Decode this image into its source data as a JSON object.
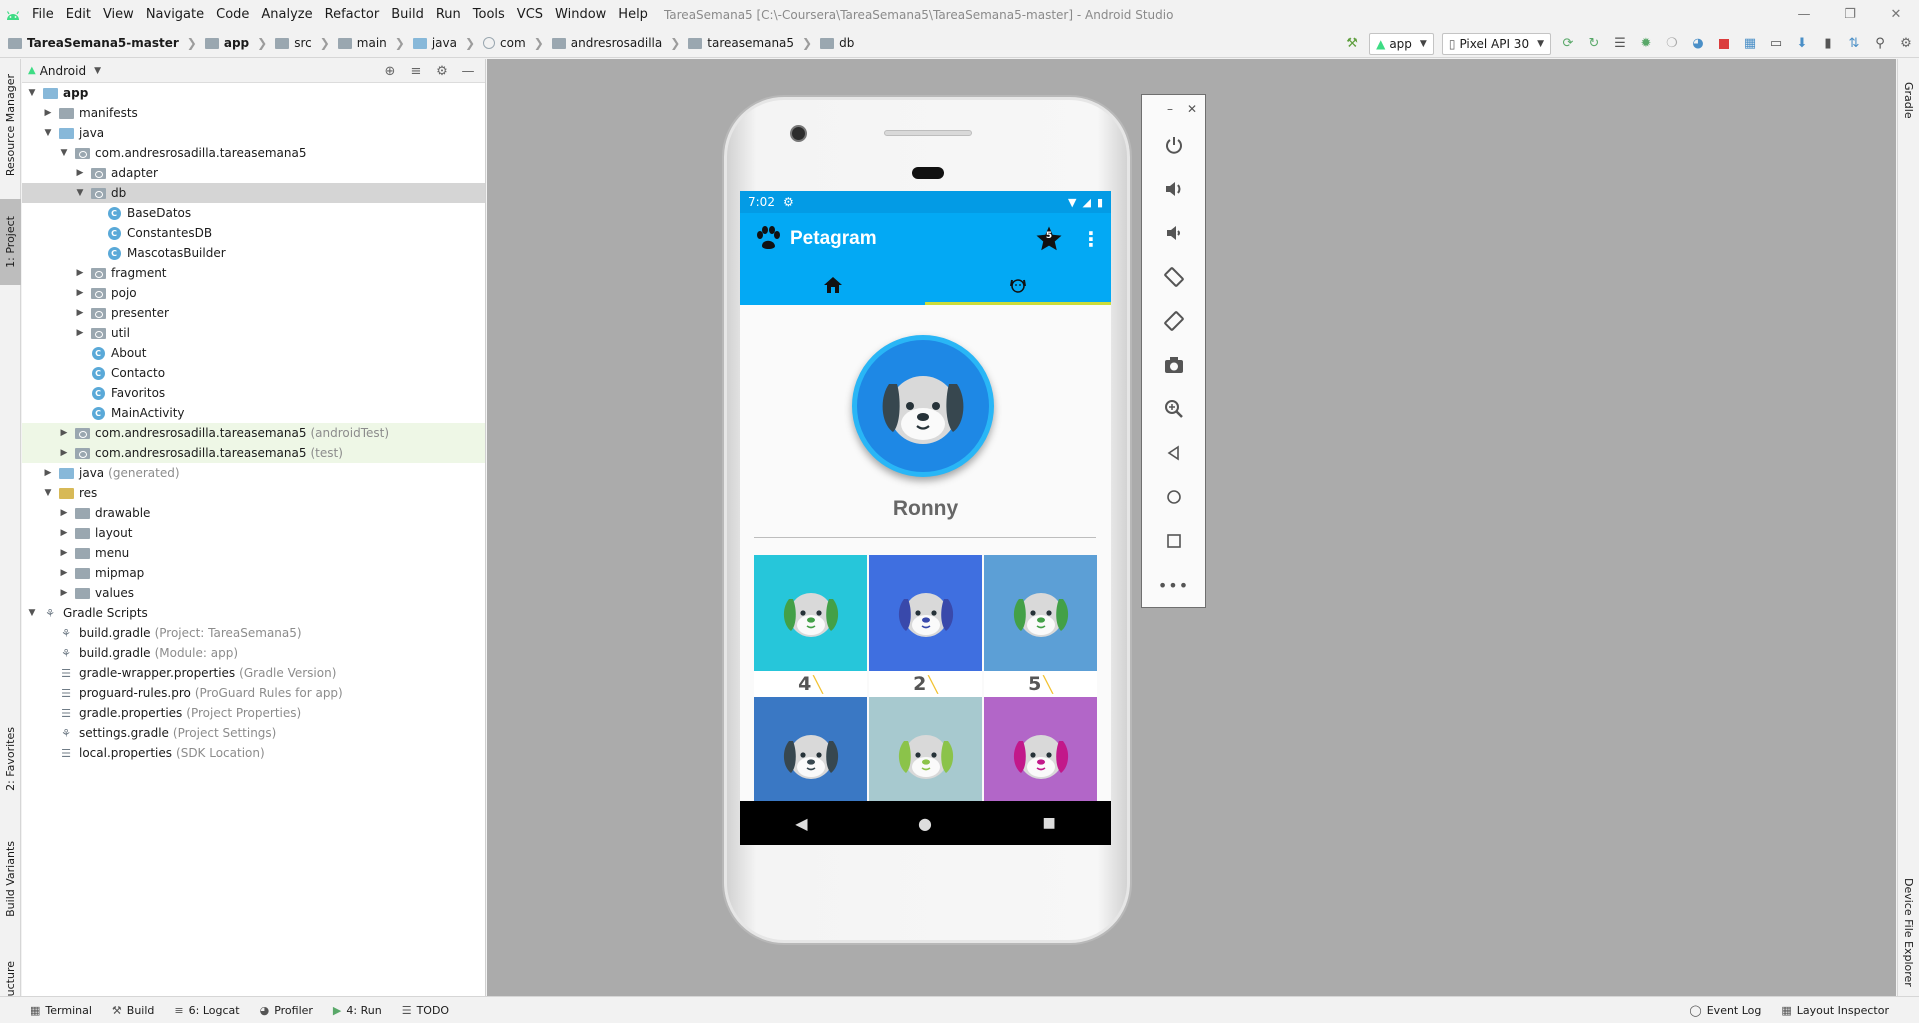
{
  "menubar": {
    "items": [
      "File",
      "Edit",
      "View",
      "Navigate",
      "Code",
      "Analyze",
      "Refactor",
      "Build",
      "Run",
      "Tools",
      "VCS",
      "Window",
      "Help"
    ],
    "title": "TareaSemana5 [C:\\-Coursera\\TareaSemana5\\TareaSemana5-master] - Android Studio"
  },
  "breadcrumbs": [
    "TareaSemana5-master",
    "app",
    "src",
    "main",
    "java",
    "com",
    "andresrosadilla",
    "tareasemana5",
    "db"
  ],
  "toolbar": {
    "run_config": "app",
    "device": "Pixel API 30"
  },
  "project_panel": {
    "view_mode": "Android",
    "tree": [
      {
        "label": "app",
        "dim": "",
        "depth": 0,
        "arrow": "open",
        "icon": "app-folder",
        "bold": true
      },
      {
        "label": "manifests",
        "dim": "",
        "depth": 1,
        "arrow": "closed",
        "icon": "folder"
      },
      {
        "label": "java",
        "dim": "",
        "depth": 1,
        "arrow": "open",
        "icon": "src-folder"
      },
      {
        "label": "com.andresrosadilla.tareasemana5",
        "dim": "",
        "depth": 2,
        "arrow": "open",
        "icon": "package"
      },
      {
        "label": "adapter",
        "dim": "",
        "depth": 3,
        "arrow": "closed",
        "icon": "package"
      },
      {
        "label": "db",
        "dim": "",
        "depth": 3,
        "arrow": "open",
        "icon": "package",
        "selected": true
      },
      {
        "label": "BaseDatos",
        "dim": "",
        "depth": 4,
        "arrow": "none",
        "icon": "class"
      },
      {
        "label": "ConstantesDB",
        "dim": "",
        "depth": 4,
        "arrow": "none",
        "icon": "class"
      },
      {
        "label": "MascotasBuilder",
        "dim": "",
        "depth": 4,
        "arrow": "none",
        "icon": "class"
      },
      {
        "label": "fragment",
        "dim": "",
        "depth": 3,
        "arrow": "closed",
        "icon": "package"
      },
      {
        "label": "pojo",
        "dim": "",
        "depth": 3,
        "arrow": "closed",
        "icon": "package"
      },
      {
        "label": "presenter",
        "dim": "",
        "depth": 3,
        "arrow": "closed",
        "icon": "package"
      },
      {
        "label": "util",
        "dim": "",
        "depth": 3,
        "arrow": "closed",
        "icon": "package"
      },
      {
        "label": "About",
        "dim": "",
        "depth": 3,
        "arrow": "none",
        "icon": "class"
      },
      {
        "label": "Contacto",
        "dim": "",
        "depth": 3,
        "arrow": "none",
        "icon": "class"
      },
      {
        "label": "Favoritos",
        "dim": "",
        "depth": 3,
        "arrow": "none",
        "icon": "class"
      },
      {
        "label": "MainActivity",
        "dim": "",
        "depth": 3,
        "arrow": "none",
        "icon": "class"
      },
      {
        "label": "com.andresrosadilla.tareasemana5",
        "dim": "(androidTest)",
        "depth": 2,
        "arrow": "closed",
        "icon": "package",
        "test": true
      },
      {
        "label": "com.andresrosadilla.tareasemana5",
        "dim": "(test)",
        "depth": 2,
        "arrow": "closed",
        "icon": "package",
        "test": true
      },
      {
        "label": "java",
        "dim": "(generated)",
        "depth": 1,
        "arrow": "closed",
        "icon": "src-folder"
      },
      {
        "label": "res",
        "dim": "",
        "depth": 1,
        "arrow": "open",
        "icon": "res-folder"
      },
      {
        "label": "drawable",
        "dim": "",
        "depth": 2,
        "arrow": "closed",
        "icon": "folder"
      },
      {
        "label": "layout",
        "dim": "",
        "depth": 2,
        "arrow": "closed",
        "icon": "folder"
      },
      {
        "label": "menu",
        "dim": "",
        "depth": 2,
        "arrow": "closed",
        "icon": "folder"
      },
      {
        "label": "mipmap",
        "dim": "",
        "depth": 2,
        "arrow": "closed",
        "icon": "folder"
      },
      {
        "label": "values",
        "dim": "",
        "depth": 2,
        "arrow": "closed",
        "icon": "folder"
      },
      {
        "label": "Gradle Scripts",
        "dim": "",
        "depth": 0,
        "arrow": "open",
        "icon": "gradle"
      },
      {
        "label": "build.gradle",
        "dim": "(Project: TareaSemana5)",
        "depth": 1,
        "arrow": "none",
        "icon": "gradle"
      },
      {
        "label": "build.gradle",
        "dim": "(Module: app)",
        "depth": 1,
        "arrow": "none",
        "icon": "gradle"
      },
      {
        "label": "gradle-wrapper.properties",
        "dim": "(Gradle Version)",
        "depth": 1,
        "arrow": "none",
        "icon": "props"
      },
      {
        "label": "proguard-rules.pro",
        "dim": "(ProGuard Rules for app)",
        "depth": 1,
        "arrow": "none",
        "icon": "props"
      },
      {
        "label": "gradle.properties",
        "dim": "(Project Properties)",
        "depth": 1,
        "arrow": "none",
        "icon": "props"
      },
      {
        "label": "settings.gradle",
        "dim": "(Project Settings)",
        "depth": 1,
        "arrow": "none",
        "icon": "gradle"
      },
      {
        "label": "local.properties",
        "dim": "(SDK Location)",
        "depth": 1,
        "arrow": "none",
        "icon": "props"
      }
    ]
  },
  "left_tabs": {
    "resource_manager": "Resource Manager",
    "project": "1: Project",
    "favorites": "2: Favorites",
    "build_variants": "Build Variants",
    "structure": "Z: Structure"
  },
  "right_tabs": {
    "gradle": "Gradle",
    "device_explorer": "Device File Explorer"
  },
  "phone": {
    "status_time": "7:02",
    "app_title": "Petagram",
    "favorites_count": "5",
    "pet_name": "Ronny",
    "grid": [
      {
        "likes": "4",
        "color": "#26c6da",
        "ears": "#43a047"
      },
      {
        "likes": "2",
        "color": "#3f6fe0",
        "ears": "#3949ab"
      },
      {
        "likes": "5",
        "color": "#5c9fd6",
        "ears": "#43a047"
      },
      {
        "likes": "",
        "color": "#3a78c4",
        "ears": "#37474f"
      },
      {
        "likes": "",
        "color": "#a7c9cf",
        "ears": "#8bc34a"
      },
      {
        "likes": "",
        "color": "#b266c8",
        "ears": "#c2188a"
      }
    ],
    "colors": {
      "status_bar": "#039be5",
      "app_bar": "#03a9f4",
      "tab_indicator": "#cddc39"
    }
  },
  "bottombar": {
    "tools": [
      "Terminal",
      "Build",
      "6: Logcat",
      "Profiler",
      "4: Run",
      "TODO"
    ],
    "right_tools": [
      "Event Log",
      "Layout Inspector"
    ]
  }
}
